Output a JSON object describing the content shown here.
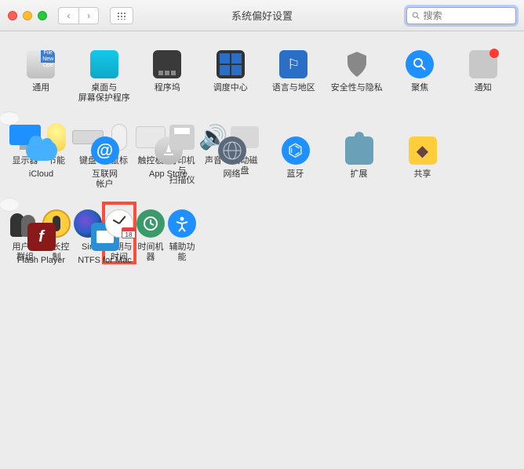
{
  "window": {
    "title": "系统偏好设置"
  },
  "search": {
    "placeholder": "搜索"
  },
  "sections": [
    {
      "tone": "normal",
      "items": [
        {
          "key": "general",
          "label": "通用"
        },
        {
          "key": "desktop",
          "label": "桌面与\n屏幕保护程序"
        },
        {
          "key": "dock",
          "label": "程序坞"
        },
        {
          "key": "mission",
          "label": "调度中心"
        },
        {
          "key": "language",
          "label": "语言与地区"
        },
        {
          "key": "security",
          "label": "安全性与隐私"
        },
        {
          "key": "spotlight",
          "label": "聚焦"
        },
        {
          "key": "notifications",
          "label": "通知"
        }
      ]
    },
    {
      "tone": "light",
      "items": [
        {
          "key": "displays",
          "label": "显示器"
        },
        {
          "key": "energy",
          "label": "节能"
        },
        {
          "key": "keyboard",
          "label": "键盘"
        },
        {
          "key": "mouse",
          "label": "鼠标"
        },
        {
          "key": "trackpad",
          "label": "触控板"
        },
        {
          "key": "printers",
          "label": "打印机与\n扫描仪"
        },
        {
          "key": "sound",
          "label": "声音"
        },
        {
          "key": "startup",
          "label": "启动磁盘"
        }
      ]
    },
    {
      "tone": "normal",
      "items": [
        {
          "key": "icloud",
          "label": "iCloud"
        },
        {
          "key": "internet",
          "label": "互联网\n帐户"
        },
        {
          "key": "appstore",
          "label": "App Store"
        },
        {
          "key": "network",
          "label": "网络"
        },
        {
          "key": "bluetooth",
          "label": "蓝牙"
        },
        {
          "key": "extensions",
          "label": "扩展"
        },
        {
          "key": "sharing",
          "label": "共享"
        }
      ]
    },
    {
      "tone": "light",
      "items": [
        {
          "key": "users",
          "label": "用户与群组"
        },
        {
          "key": "parental",
          "label": "家长控制"
        },
        {
          "key": "siri",
          "label": "Siri"
        },
        {
          "key": "datetime",
          "label": "日期与时间",
          "highlighted": true
        },
        {
          "key": "timemachine",
          "label": "时间机器"
        },
        {
          "key": "accessibility",
          "label": "辅助功能"
        }
      ]
    },
    {
      "tone": "normal",
      "items": [
        {
          "key": "flash",
          "label": "Flash Player"
        },
        {
          "key": "ntfs",
          "label": "NTFS for Mac"
        }
      ]
    }
  ]
}
